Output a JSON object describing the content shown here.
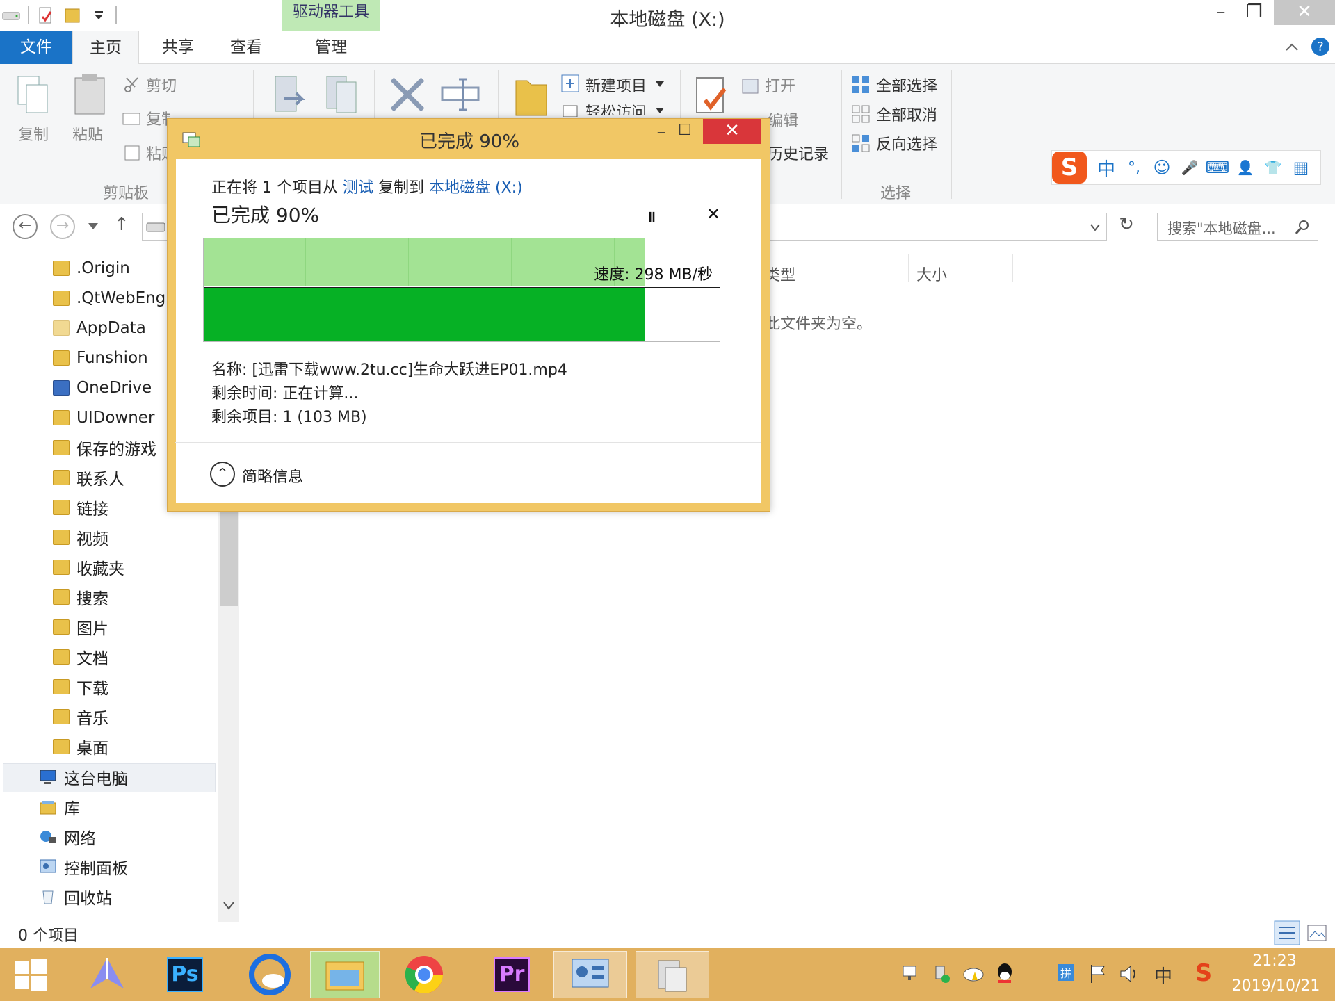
{
  "window": {
    "title": "本地磁盘 (X:)",
    "context_tab": "驱动器工具",
    "min_glyph": "–",
    "max_glyph": "❐",
    "close_glyph": "✕"
  },
  "tabs": {
    "file": "文件",
    "home": "主页",
    "share": "共享",
    "view": "查看",
    "manage": "管理"
  },
  "ribbon": {
    "copy": "复制",
    "paste": "粘贴",
    "cut": "剪切",
    "copy_path": "复制路径",
    "paste_shortcut": "粘贴",
    "clipboard": "剪贴板",
    "new_item": "新建项目",
    "easy_access": "轻松访问",
    "open": "打开",
    "edit": "编辑",
    "history": "历史记录",
    "select_all": "全部选择",
    "select_none": "全部取消",
    "invert": "反向选择",
    "select_group": "选择"
  },
  "ime_bar": {
    "logo": "S",
    "items": [
      "中",
      "°,",
      "☺",
      "🎤",
      "⌨",
      "👤",
      "👕",
      "▦"
    ]
  },
  "nav": {
    "search_placeholder": "搜索\"本地磁盘...",
    "back": "←",
    "forward": "→",
    "up": "↑",
    "refresh": "↻"
  },
  "tree": [
    {
      "label": ".Origin"
    },
    {
      "label": ".QtWebEng"
    },
    {
      "label": "AppData"
    },
    {
      "label": "Funshion"
    },
    {
      "label": "OneDrive"
    },
    {
      "label": "UIDowner"
    },
    {
      "label": "保存的游戏"
    },
    {
      "label": "联系人"
    },
    {
      "label": "链接"
    },
    {
      "label": "视频"
    },
    {
      "label": "收藏夹"
    },
    {
      "label": "搜索"
    },
    {
      "label": "图片"
    },
    {
      "label": "文档"
    },
    {
      "label": "下载"
    },
    {
      "label": "音乐"
    },
    {
      "label": "桌面"
    }
  ],
  "tree_system": [
    {
      "label": "这台电脑"
    },
    {
      "label": "库"
    },
    {
      "label": "网络"
    },
    {
      "label": "控制面板"
    },
    {
      "label": "回收站"
    }
  ],
  "columns": {
    "type": "类型",
    "size": "大小"
  },
  "empty_message": "此文件夹为空。",
  "status": {
    "count": "0 个项目"
  },
  "taskbar": {
    "time": "21:23",
    "date": "2019/10/21",
    "ps_label": "Ps",
    "pr_label": "Pr",
    "ime_indicator": "中"
  },
  "copy_dialog": {
    "title": "已完成 90%",
    "line_prefix": "正在将 1 个项目从",
    "source": "测试",
    "line_mid": "复制到",
    "dest": "本地磁盘 (X:)",
    "heading": "已完成 90%",
    "progress": 0.9,
    "pause_glyph": "॥",
    "cancel_glyph": "✕",
    "speed": "速度: 298 MB/秒",
    "name": "名称: [迅雷下载www.2tu.cc]生命大跃进EP01.mp4",
    "time_left": "剩余时间: 正在计算...",
    "items_left": "剩余项目: 1 (103 MB)",
    "less_details": "简略信息",
    "expand_glyph": "^"
  },
  "colors": {
    "accent": "#1a73c7",
    "dialog_frame": "#f1c765",
    "progress_light": "#a3e394",
    "progress_dark": "#06b125",
    "close_red": "#d9363a",
    "taskbar": "#e1b05e"
  }
}
